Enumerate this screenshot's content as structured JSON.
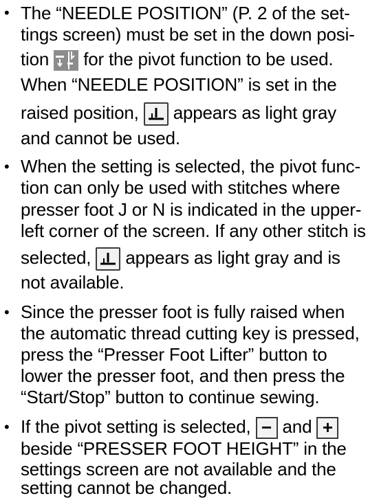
{
  "bullets": [
    {
      "lines": [
        "The “NEEDLE POSITION” (P. 2 of the set-",
        "tings screen) must be set in the down posi-",
        [
          "tion",
          "for the pivot function to be used."
        ],
        "When “NEEDLE POSITION” is set in the",
        [
          "raised position,",
          "appears as light gray"
        ],
        "and cannot be used."
      ]
    },
    {
      "lines": [
        "When the setting is selected, the pivot func-",
        "tion can only be used with stitches where",
        "presser foot J or N is indicated in the upper-",
        "left corner of the screen. If any other stitch is",
        [
          "selected,",
          "appears as light gray and is"
        ],
        "not available."
      ]
    },
    {
      "lines": [
        "Since the presser foot is fully raised when",
        "the automatic thread cutting key is pressed,",
        "press the “Presser Foot Lifter” button to",
        "lower the presser foot, and then press the",
        "“Start/Stop” button to continue sewing."
      ]
    },
    {
      "lines": [
        [
          "If the pivot setting is selected,",
          "and"
        ],
        "beside “PRESSER FOOT HEIGHT” in the",
        "settings screen are not available and the",
        "setting cannot be changed."
      ]
    }
  ],
  "icons": {
    "needle_down": "needle-down-position-icon",
    "pivot": "pivot-icon",
    "minus": "−",
    "plus": "+"
  }
}
